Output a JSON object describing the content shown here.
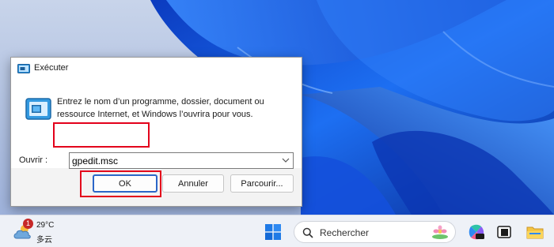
{
  "dialog": {
    "title": "Exécuter",
    "description": "Entrez le nom d’un programme, dossier, document ou ressource Internet, et Windows l’ouvrira pour vous.",
    "open_label": "Ouvrir :",
    "command_value": "gpedit.msc",
    "buttons": {
      "ok": "OK",
      "cancel": "Annuler",
      "browse": "Parcourir..."
    },
    "icons": {
      "title": "run-app-icon",
      "program": "run-program-icon",
      "dropdown": "chevron-down-icon"
    },
    "highlight_color": "#e3001b"
  },
  "taskbar": {
    "weather": {
      "badge": "1",
      "temperature": "29°C",
      "condition": "多云",
      "icon": "cloud-sun-icon"
    },
    "search": {
      "placeholder": "Rechercher",
      "icon": "search-icon"
    },
    "icons": [
      "windows-start-icon",
      "copilot-icon",
      "task-view-icon",
      "file-explorer-icon"
    ]
  },
  "colors": {
    "wallpaper_blue": "#1a5fe8",
    "ok_border": "#2b66c8"
  }
}
